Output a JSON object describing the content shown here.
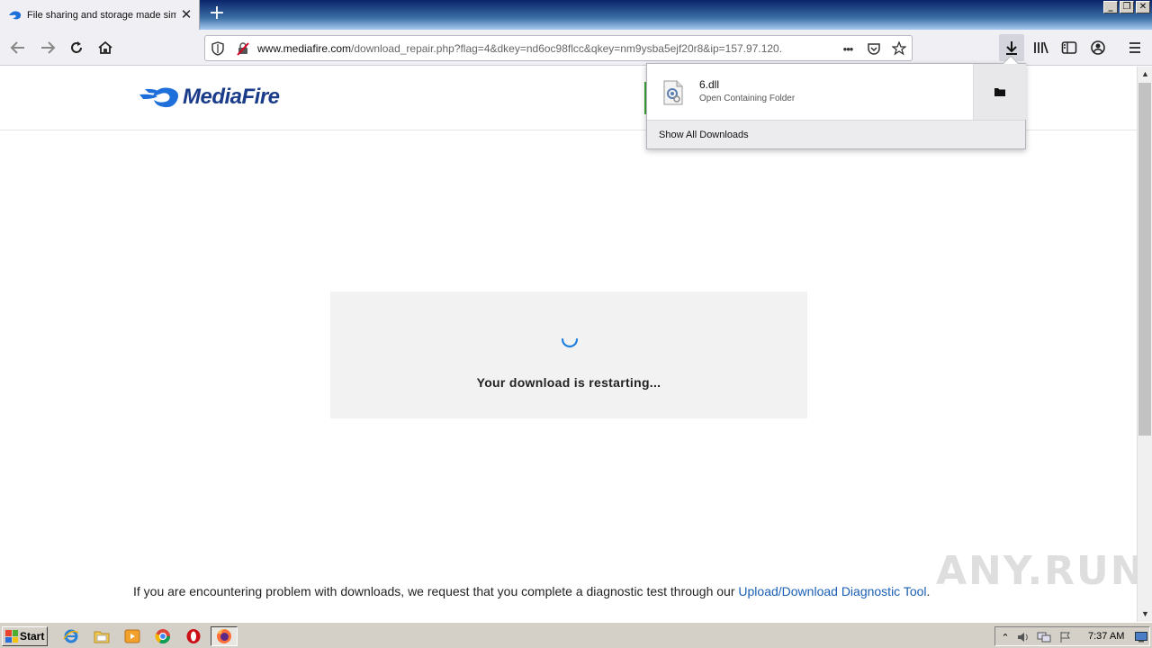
{
  "browser": {
    "tab": {
      "title": "File sharing and storage made simple",
      "favicon": "mediafire-favicon"
    },
    "new_tab_label": "+",
    "window_buttons": [
      "_",
      "❐",
      "✕"
    ],
    "url_host": "www.mediafire.com",
    "url_path": "/download_repair.php?flag=4&dkey=nd6oc98flcc&qkey=nm9ysba5ejf20r8&ip=157.97.120.",
    "url_more": "•••"
  },
  "downloads_panel": {
    "file_name": "6.dll",
    "status": "Open Containing Folder",
    "show_all": "Show All Downloads"
  },
  "page": {
    "logo_text": "MediaFire",
    "message": "Your download is restarting...",
    "footer_text": "If you are encountering problem with downloads, we request that you complete a diagnostic test through our ",
    "footer_link": "Upload/Download Diagnostic Tool",
    "footer_end": ".",
    "watermark": "ANY.RUN"
  },
  "taskbar": {
    "start_label": "Start",
    "clock": "7:37 AM"
  },
  "colors": {
    "brand_blue": "#1a3a8a",
    "link": "#1a5fb4",
    "spinner": "#1e7fe0"
  }
}
